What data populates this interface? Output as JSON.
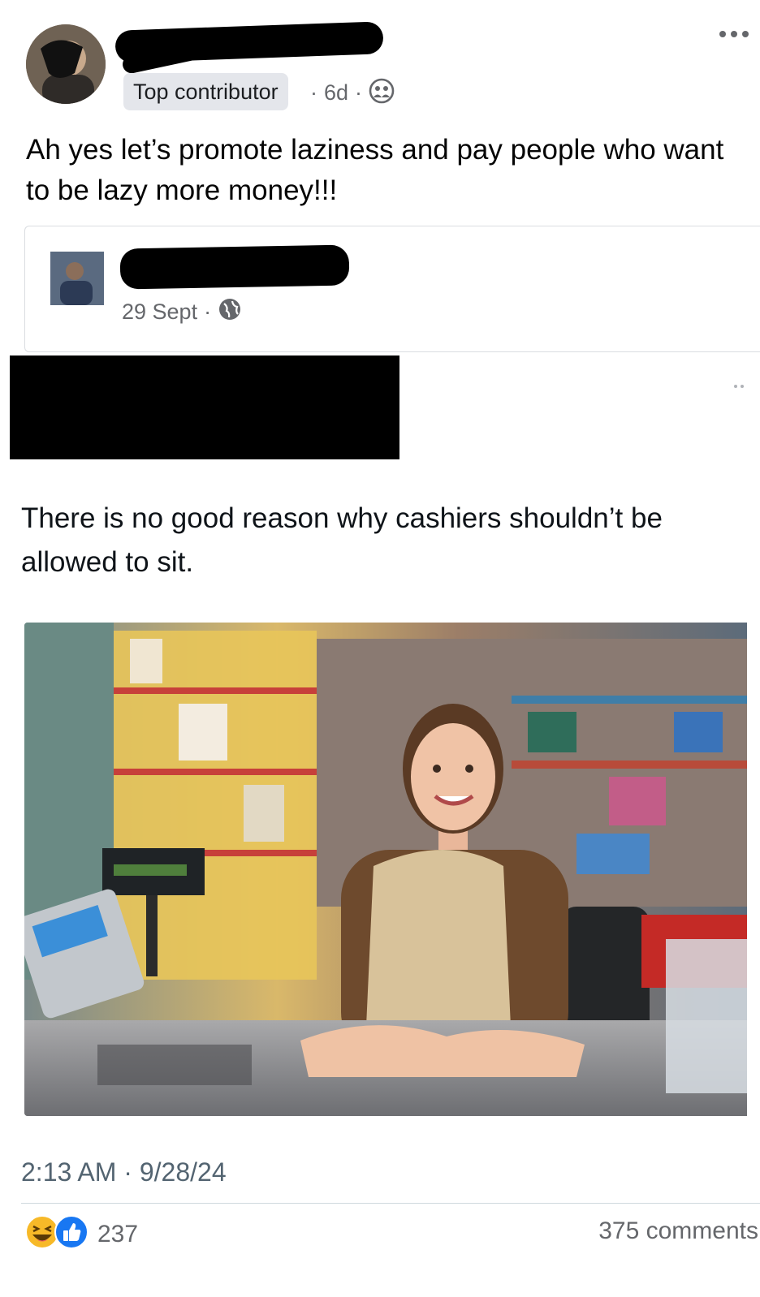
{
  "post": {
    "badge": "Top contributor",
    "sep1": "·",
    "time": "6d",
    "sep2": "·",
    "text": "Ah yes let’s promote laziness and pay people who want to be lazy more money!!!"
  },
  "shared": {
    "date": "29 Sept",
    "sep": "·",
    "tweet_line1": "There is no good reason why cashiers shouldn’t be",
    "tweet_line2": "allowed to sit.",
    "timestamp": "2:13 AM · 9/28/24"
  },
  "footer": {
    "reaction_count": "237",
    "comments": "375 comments"
  },
  "icons": {
    "privacy": "friends-icon",
    "audience": "globe-icon",
    "reactions": [
      "haha-reaction-icon",
      "like-reaction-icon"
    ]
  },
  "colors": {
    "like": "#1877f2",
    "haha": "#f7b928",
    "meta_text": "#65676b"
  }
}
